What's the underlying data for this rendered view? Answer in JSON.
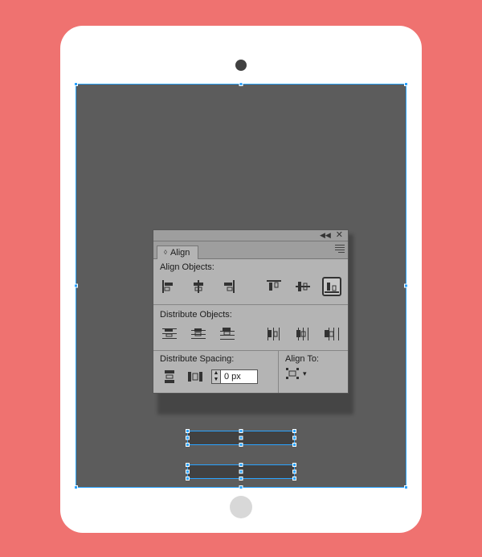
{
  "panel": {
    "tab_label": "Align",
    "sections": {
      "align_objects": "Align Objects:",
      "distribute_objects": "Distribute Objects:",
      "distribute_spacing": "Distribute Spacing:",
      "align_to": "Align To:"
    },
    "spacing_value": "0 px",
    "icons": {
      "align_left": "align-left",
      "align_hcenter": "align-horizontal-center",
      "align_right": "align-right",
      "align_top": "align-top",
      "align_vcenter": "align-vertical-center",
      "align_bottom": "align-bottom",
      "dist_top": "distribute-top",
      "dist_vcenter": "distribute-vertical-center",
      "dist_bottom": "distribute-bottom",
      "dist_left": "distribute-left",
      "dist_hcenter": "distribute-horizontal-center",
      "dist_right": "distribute-right",
      "space_v": "distribute-space-vertical",
      "space_h": "distribute-space-horizontal",
      "align_to_target": "align-to-selection"
    },
    "selected_button": "align_bottom"
  },
  "artwork": {
    "background_color": "#ef7270",
    "device": {
      "body_color": "#ffffff",
      "camera_color": "#414141",
      "screen_color": "#5c5c5c",
      "home_color": "#d8d8d8"
    },
    "bars": [
      {
        "id": "bar-a",
        "color": "#414141"
      },
      {
        "id": "bar-b",
        "color": "#414141"
      }
    ],
    "selection_color": "#2aa3ff",
    "selected_objects": [
      "screen",
      "bar-a",
      "bar-b"
    ]
  }
}
